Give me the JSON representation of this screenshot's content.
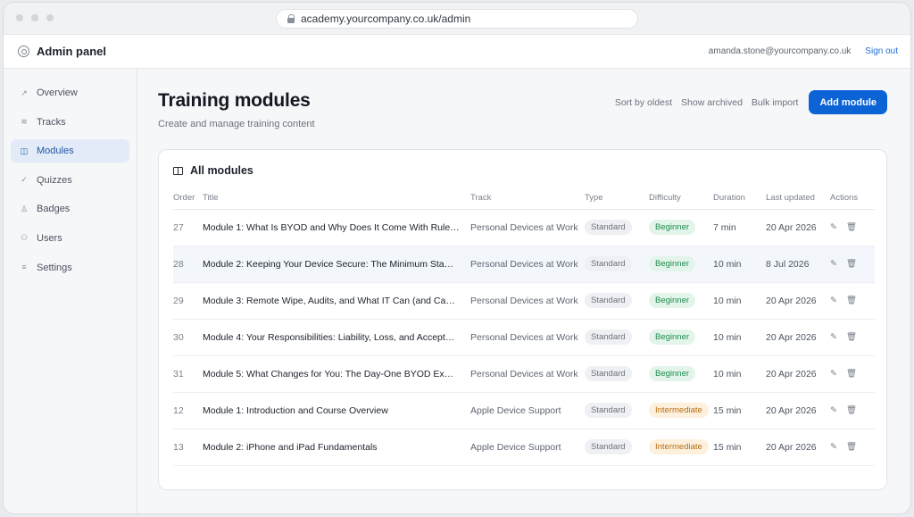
{
  "browser": {
    "url": "academy.yourcompany.co.uk/admin"
  },
  "header": {
    "title": "Admin panel",
    "email": "amanda.stone@yourcompany.co.uk",
    "signout": "Sign out"
  },
  "sidebar": {
    "items": [
      {
        "label": "Overview",
        "icon": "trend-icon",
        "glyph": "↗"
      },
      {
        "label": "Tracks",
        "icon": "layers-icon",
        "glyph": "≋"
      },
      {
        "label": "Modules",
        "icon": "book-icon",
        "glyph": "◫"
      },
      {
        "label": "Quizzes",
        "icon": "check-icon",
        "glyph": "✓"
      },
      {
        "label": "Badges",
        "icon": "badge-icon",
        "glyph": "♙"
      },
      {
        "label": "Users",
        "icon": "users-icon",
        "glyph": "⚇"
      },
      {
        "label": "Settings",
        "icon": "filter-icon",
        "glyph": "≡"
      }
    ],
    "active": "Modules"
  },
  "page": {
    "title": "Training modules",
    "subtitle": "Create and manage training content",
    "actions": {
      "sort": "Sort by oldest",
      "archived": "Show archived",
      "bulk": "Bulk import",
      "add": "Add module"
    }
  },
  "card": {
    "title": "All modules",
    "columns": [
      "Order",
      "Title",
      "Track",
      "Type",
      "Difficulty",
      "Duration",
      "Last updated",
      "Actions"
    ],
    "rows": [
      {
        "order": "27",
        "title": "Module 1: What Is BYOD and Why Does It Come With Rule…",
        "track": "Personal Devices at Work",
        "type": "Standard",
        "difficulty": "Beginner",
        "duration": "7 min",
        "updated": "20 Apr 2026"
      },
      {
        "order": "28",
        "title": "Module 2: Keeping Your Device Secure: The Minimum Sta…",
        "track": "Personal Devices at Work",
        "type": "Standard",
        "difficulty": "Beginner",
        "duration": "10 min",
        "updated": "8 Jul 2026"
      },
      {
        "order": "29",
        "title": "Module 3: Remote Wipe, Audits, and What IT Can (and Ca…",
        "track": "Personal Devices at Work",
        "type": "Standard",
        "difficulty": "Beginner",
        "duration": "10 min",
        "updated": "20 Apr 2026"
      },
      {
        "order": "30",
        "title": "Module 4: Your Responsibilities: Liability, Loss, and Accept…",
        "track": "Personal Devices at Work",
        "type": "Standard",
        "difficulty": "Beginner",
        "duration": "10 min",
        "updated": "20 Apr 2026"
      },
      {
        "order": "31",
        "title": "Module 5: What Changes for You: The Day-One BYOD Ex…",
        "track": "Personal Devices at Work",
        "type": "Standard",
        "difficulty": "Beginner",
        "duration": "10 min",
        "updated": "20 Apr 2026"
      },
      {
        "order": "12",
        "title": "Module 1: Introduction and Course Overview",
        "track": "Apple Device Support",
        "type": "Standard",
        "difficulty": "Intermediate",
        "duration": "15 min",
        "updated": "20 Apr 2026"
      },
      {
        "order": "13",
        "title": "Module 2: iPhone and iPad Fundamentals",
        "track": "Apple Device Support",
        "type": "Standard",
        "difficulty": "Intermediate",
        "duration": "15 min",
        "updated": "20 Apr 2026"
      }
    ],
    "highlight_row": 1
  },
  "colors": {
    "accent": "#0b63d6",
    "beginner": "#1f8a4c",
    "intermediate": "#b66d12"
  }
}
